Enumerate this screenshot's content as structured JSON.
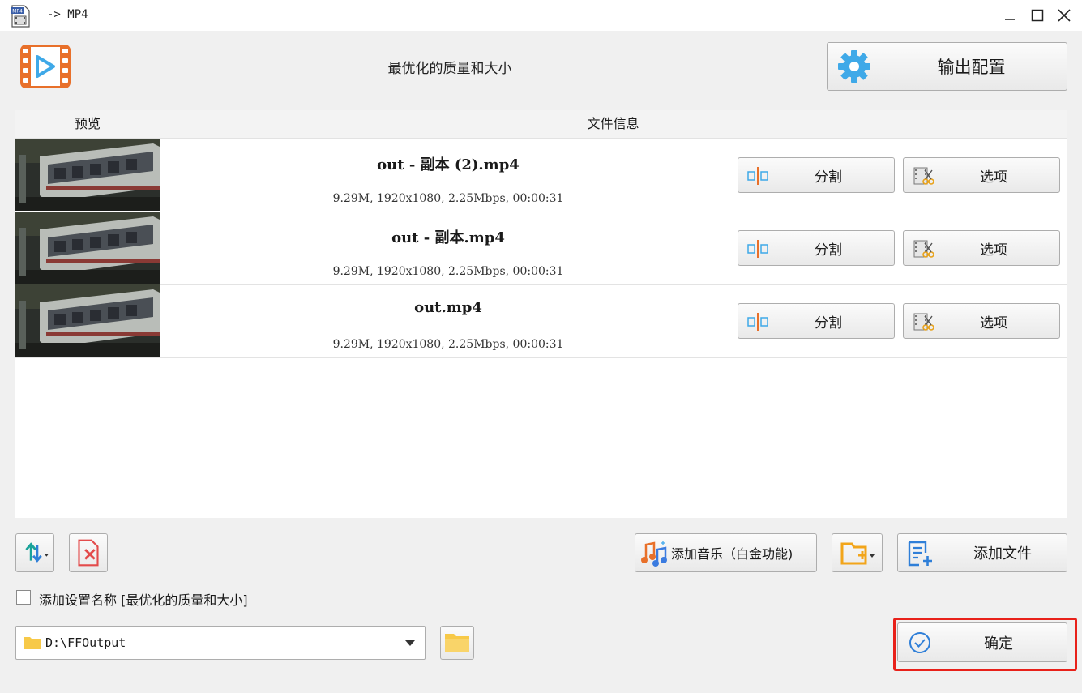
{
  "window": {
    "title": "-> MP4",
    "app_icon_text": "MP4",
    "controls": [
      "minimize-icon",
      "maximize-icon",
      "close-icon"
    ]
  },
  "header": {
    "preset_title": "最优化的质量和大小",
    "output_config_label": "输出配置"
  },
  "table": {
    "columns": [
      "预览",
      "文件信息"
    ],
    "rows": [
      {
        "name": "out - 副本 (2).mp4",
        "meta": "9.29M, 1920x1080, 2.25Mbps, 00:00:31",
        "split_label": "分割",
        "options_label": "选项"
      },
      {
        "name": "out - 副本.mp4",
        "meta": "9.29M, 1920x1080, 2.25Mbps, 00:00:31",
        "split_label": "分割",
        "options_label": "选项"
      },
      {
        "name": "out.mp4",
        "meta": "9.29M, 1920x1080, 2.25Mbps, 00:00:31",
        "split_label": "分割",
        "options_label": "选项"
      }
    ]
  },
  "toolbar": {
    "add_music_label": "添加音乐（白金功能)",
    "add_file_label": "添加文件"
  },
  "settings": {
    "add_name_checked": false,
    "add_name_label": "添加设置名称 [最优化的质量和大小]",
    "output_path": "D:\\FFOutput",
    "ok_label": "确定"
  },
  "colors": {
    "accent_orange": "#e8702a",
    "gear_blue": "#3fa9e8",
    "highlight_red": "#e8211a",
    "folder_yellow": "#f7c948"
  }
}
